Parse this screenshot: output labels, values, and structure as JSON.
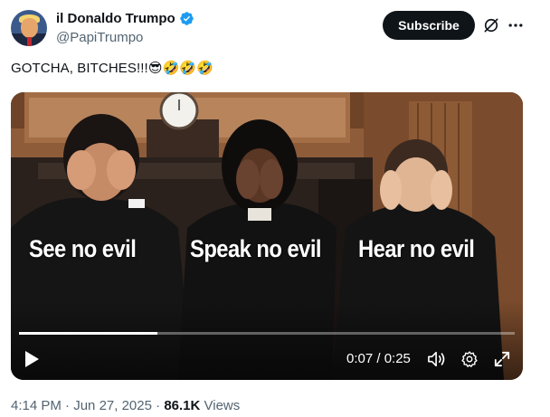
{
  "author": {
    "display_name": "il Donaldo Trumpo",
    "handle": "@PapiTrumpo",
    "verified": true
  },
  "actions": {
    "subscribe_label": "Subscribe",
    "grok_icon": "grok-icon",
    "more_icon": "more-options-icon"
  },
  "tweet": {
    "text": "GOTCHA, BITCHES!!!😎🤣🤣🤣"
  },
  "video": {
    "captions": [
      "See no evil",
      "Speak no evil",
      "Hear no evil"
    ],
    "current_time": "0:07",
    "duration": "0:25",
    "time_display": "0:07 / 0:25",
    "progress": 0.28,
    "controls": [
      "play-icon",
      "volume-icon",
      "settings-icon",
      "fullscreen-icon"
    ]
  },
  "meta": {
    "time": "4:14 PM",
    "date": "Jun 27, 2025",
    "separator": " · ",
    "views_count": "86.1K",
    "views_label": " Views"
  },
  "colors": {
    "text_primary": "#0f1419",
    "text_secondary": "#536471",
    "verified_blue": "#1d9bf0",
    "subscribe_bg": "#0f1419"
  }
}
